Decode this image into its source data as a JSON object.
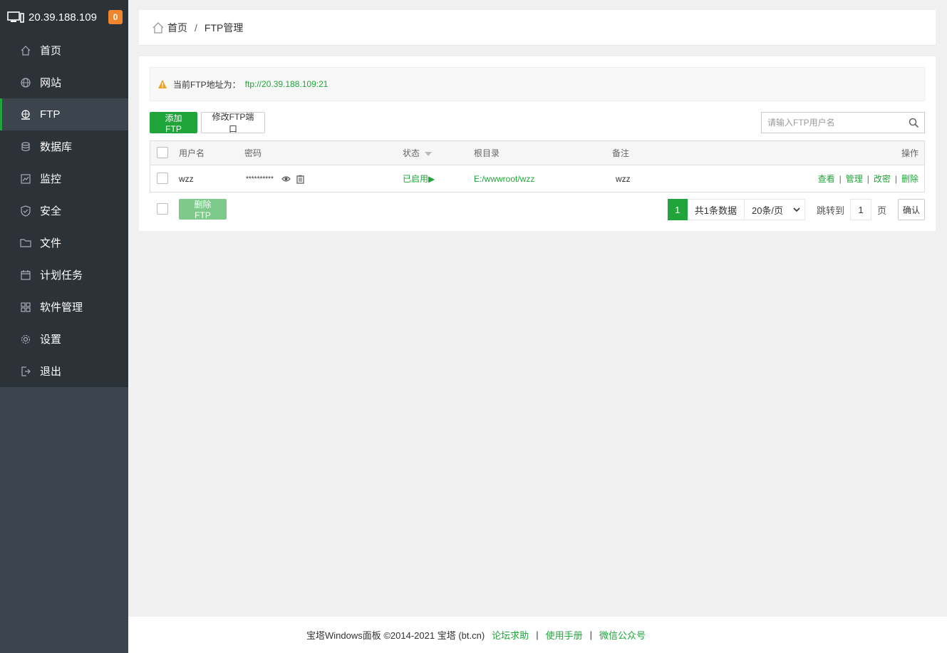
{
  "server": {
    "ip": "20.39.188.109",
    "badge": "0"
  },
  "menu": [
    {
      "label": "首页",
      "icon": "home-icon"
    },
    {
      "label": "网站",
      "icon": "globe-icon"
    },
    {
      "label": "FTP",
      "icon": "ftp-icon",
      "active": true
    },
    {
      "label": "数据库",
      "icon": "database-icon"
    },
    {
      "label": "监控",
      "icon": "monitor-icon"
    },
    {
      "label": "安全",
      "icon": "shield-icon"
    },
    {
      "label": "文件",
      "icon": "folder-icon"
    },
    {
      "label": "计划任务",
      "icon": "calendar-icon"
    },
    {
      "label": "软件管理",
      "icon": "grid-icon"
    },
    {
      "label": "设置",
      "icon": "gear-icon"
    },
    {
      "label": "退出",
      "icon": "logout-icon"
    }
  ],
  "breadcrumb": {
    "home": "首页",
    "sep": "/",
    "current": "FTP管理"
  },
  "notice": {
    "label": "当前FTP地址为：",
    "address": "ftp://20.39.188.109:21"
  },
  "toolbar": {
    "add_label": "添加FTP",
    "port_label": "修改FTP端口",
    "search_placeholder": "请输入FTP用户名"
  },
  "table": {
    "headers": {
      "username": "用户名",
      "password": "密码",
      "status": "状态",
      "root": "根目录",
      "remark": "备注",
      "actions": "操作"
    },
    "rows": [
      {
        "username": "wzz",
        "password": "**********",
        "status": "已启用",
        "status_icon": "▶",
        "root": "E:/wwwroot/wzz",
        "remark": "wzz"
      }
    ],
    "actions": {
      "view": "查看",
      "manage": "管理",
      "change_pwd": "改密",
      "delete": "删除",
      "sep": "|"
    }
  },
  "bulk": {
    "delete_label": "删除FTP"
  },
  "pager": {
    "current": "1",
    "total": "共1条数据",
    "page_size": "20条/页",
    "jump_label": "跳转到",
    "jump_value": "1",
    "unit": "页",
    "confirm": "确认"
  },
  "footer": {
    "copyright": "宝塔Windows面板 ©2014-2021 宝塔 (bt.cn)",
    "links": [
      "论坛求助",
      "使用手册",
      "微信公众号"
    ],
    "sep": "|"
  },
  "colors": {
    "accent": "#20a53a",
    "sidebar": "#3c444d",
    "sidebar_dark": "#2b3238",
    "badge": "#f0852d"
  }
}
